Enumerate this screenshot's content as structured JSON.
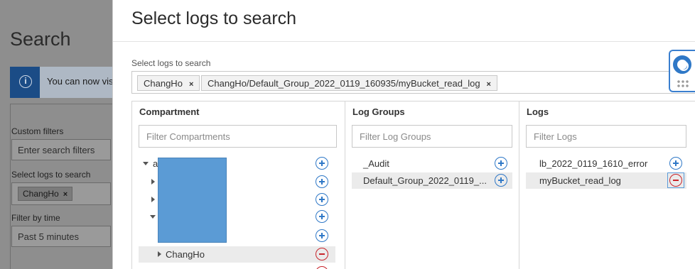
{
  "background_page": {
    "title": "Search",
    "banner_text": "You can now vis",
    "custom_filters_label": "Custom filters",
    "custom_filters_placeholder": "Enter search filters",
    "select_logs_label": "Select logs to search",
    "selected_chip": "ChangHo",
    "chip_close": "×",
    "filter_time_label": "Filter by time",
    "filter_time_value": "Past 5 minutes"
  },
  "modal": {
    "title": "Select logs to search",
    "selector_label": "Select logs to search",
    "chips": [
      {
        "label": "ChangHo",
        "close": "×"
      },
      {
        "label": "ChangHo/Default_Group_2022_0119_160935/myBucket_read_log",
        "close": "×"
      }
    ],
    "columns": {
      "compartment": {
        "header": "Compartment",
        "filter_placeholder": "Filter Compartments",
        "items": [
          {
            "label": "ap",
            "expanded": true,
            "action": "add"
          },
          {
            "label": "",
            "expanded": false,
            "action": "add"
          },
          {
            "label": "",
            "expanded": false,
            "action": "add"
          },
          {
            "label": "",
            "expanded": true,
            "action": "add"
          },
          {
            "label": "",
            "expanded": null,
            "action": "add"
          },
          {
            "label": "ChangHo",
            "expanded": false,
            "action": "remove",
            "selected": true
          }
        ]
      },
      "log_groups": {
        "header": "Log Groups",
        "filter_placeholder": "Filter Log Groups",
        "items": [
          {
            "label": "_Audit",
            "action": "add"
          },
          {
            "label": "Default_Group_2022_0119_...",
            "action": "add",
            "selected": true
          }
        ]
      },
      "logs": {
        "header": "Logs",
        "filter_placeholder": "Filter Logs",
        "items": [
          {
            "label": "lb_2022_0119_1610_error",
            "action": "add"
          },
          {
            "label": "myBucket_read_log",
            "action": "remove",
            "selected": true
          }
        ]
      }
    }
  },
  "help_widget": {
    "icon": "lifebuoy-icon"
  },
  "colors": {
    "accent": "#2f78c7",
    "remove": "#c8242b",
    "redaction": "#5b9bd5",
    "banner_strip": "#1b4c86"
  }
}
